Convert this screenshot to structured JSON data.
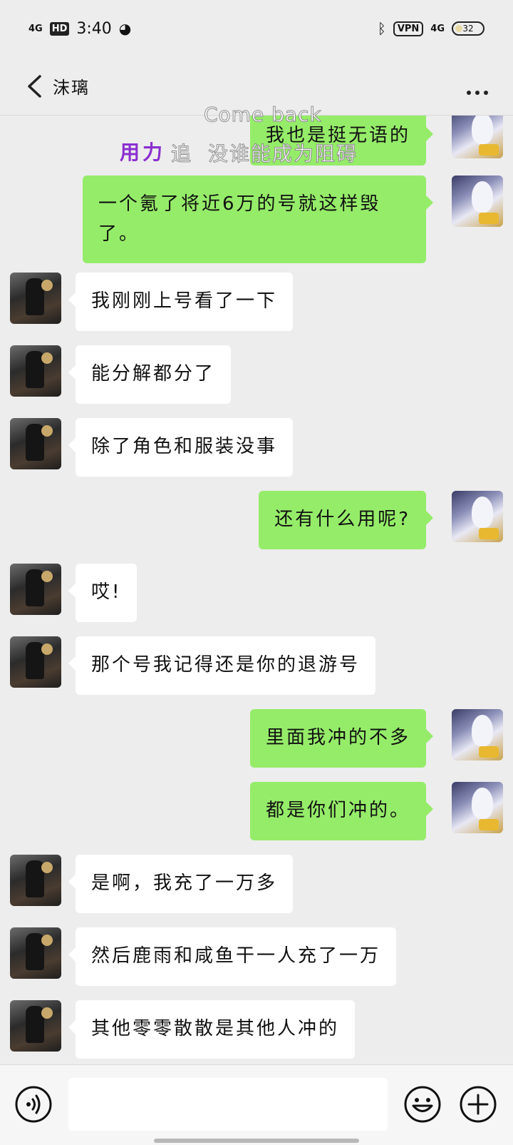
{
  "status_bar": {
    "signal": "4G",
    "hd": "HD",
    "time": "3:40",
    "vpn": "VPN",
    "network": "4G",
    "battery": "32"
  },
  "header": {
    "title": "沫璃"
  },
  "overlay": {
    "line1": "Come back",
    "line2_a": "用力",
    "line2_b": "追",
    "line2_c": "没谁能成为阻碍"
  },
  "messages": [
    {
      "side": "right",
      "text": "我也是挺无语的"
    },
    {
      "side": "right",
      "text": "一个氪了将近6万的号就这样毁了。"
    },
    {
      "side": "left",
      "text": "我刚刚上号看了一下"
    },
    {
      "side": "left",
      "text": "能分解都分了"
    },
    {
      "side": "left",
      "text": "除了角色和服装没事"
    },
    {
      "side": "right",
      "text": "还有什么用呢?"
    },
    {
      "side": "left",
      "text": "哎!"
    },
    {
      "side": "left",
      "text": "那个号我记得还是你的退游号"
    },
    {
      "side": "right",
      "text": "里面我冲的不多"
    },
    {
      "side": "right",
      "text": "都是你们冲的。"
    },
    {
      "side": "left",
      "text": "是啊，我充了一万多"
    },
    {
      "side": "left",
      "text": "然后鹿雨和咸鱼干一人充了一万"
    },
    {
      "side": "left",
      "text": "其他零零散散是其他人冲的"
    }
  ],
  "input": {
    "value": "",
    "placeholder": ""
  },
  "icons": {
    "back": "back-arrow-icon",
    "more": "more-dots-icon",
    "voice": "voice-icon",
    "emoji": "emoji-icon",
    "plus": "plus-icon"
  },
  "colors": {
    "background": "#ededed",
    "own_bubble": "#95ec69",
    "other_bubble": "#ffffff",
    "overlay_purple": "#8b2fd0"
  }
}
